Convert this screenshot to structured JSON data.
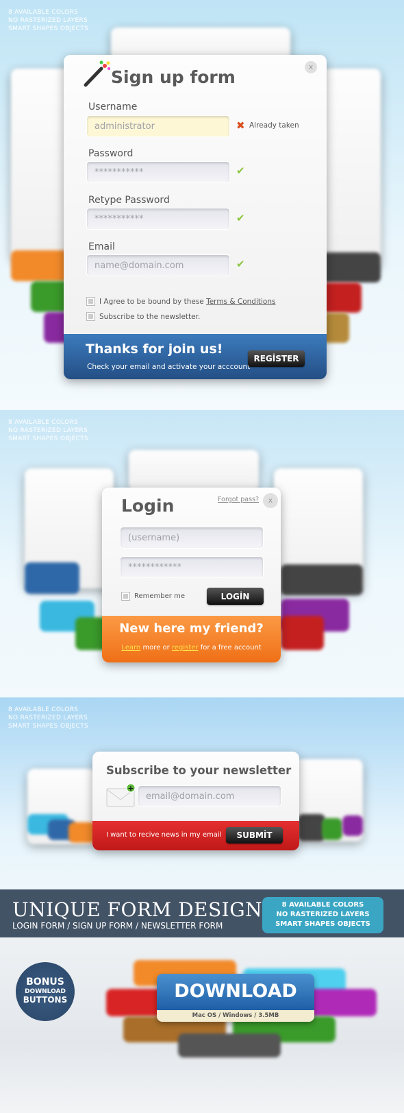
{
  "features": [
    "8 AVAILABLE COLORS",
    "NO RASTERIZED LAYERS",
    "SMART SHAPES OBJECTS"
  ],
  "signup": {
    "title": "Sign up form",
    "close": "x",
    "username_label": "Username",
    "username_value": "administrator",
    "username_status": "Already taken",
    "password_label": "Password",
    "password_value": "***********",
    "retype_label": "Retype Password",
    "retype_value": "***********",
    "email_label": "Email",
    "email_placeholder": "name@domain.com",
    "agree_text": "I Agree to be bound by these ",
    "terms_link": "Terms & Conditions",
    "subscribe_text": "Subscribe to the newsletter.",
    "footer_title": "Thanks for join us!",
    "footer_sub": "Check your email and activate your acccount",
    "register_button": "REGİSTER",
    "footer_color": "#2f68a8"
  },
  "login": {
    "title": "Login",
    "forgot": "Forgot pass?",
    "close": "x",
    "username_placeholder": "(username)",
    "password_value": "************",
    "remember": "Remember me",
    "login_button": "LOGİN",
    "footer_title": "New here my friend?",
    "learn_link": "Learn",
    "more_or": " more or ",
    "register_link": "register",
    "free_account": " for a free account",
    "footer_color": "#f5832a"
  },
  "newsletter": {
    "title": "Subscribe to your newsletter",
    "email_placeholder": "email@domain.com",
    "footer_text": "I want to recive news in my email",
    "submit_button": "SUBMİT",
    "footer_color": "#d42424"
  },
  "banner": {
    "title": "UNIQUE FORM DESIGNS",
    "subtitle": "LOGIN FORM / SIGN UP FORM / NEWSLETTER FORM",
    "features": [
      "8 AVAILABLE COLORS",
      "NO RASTERIZED LAYERS",
      "SMART SHAPES OBJECTS"
    ]
  },
  "bonus": {
    "line1": "BONUS",
    "line2": "DOWNLOAD",
    "line3": "BUTTONS",
    "download_label": "DOWNLOAD",
    "download_info": "Mac OS / Windows / 3.5MB"
  },
  "icons": {
    "wand": "magic-wand-icon",
    "error": "x-mark-icon",
    "valid": "check-icon",
    "mail": "envelope-add-icon"
  }
}
